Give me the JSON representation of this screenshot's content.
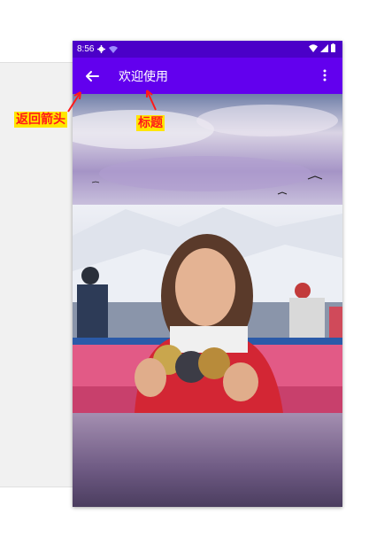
{
  "status_bar": {
    "time": "8:56"
  },
  "app_bar": {
    "title": "欢迎使用"
  },
  "annotations": {
    "back_arrow_label": "返回箭头",
    "title_label": "标题"
  },
  "colors": {
    "status_bar": "#4b00c8",
    "app_bar": "#6200ee",
    "annotation_bg": "#ffe600",
    "annotation_text": "#ff1a1a"
  },
  "icons": {
    "back": "arrow-left",
    "menu": "more-vertical",
    "settings": "gear",
    "wifi": "wifi",
    "signal": "cell-signal",
    "battery": "battery"
  }
}
